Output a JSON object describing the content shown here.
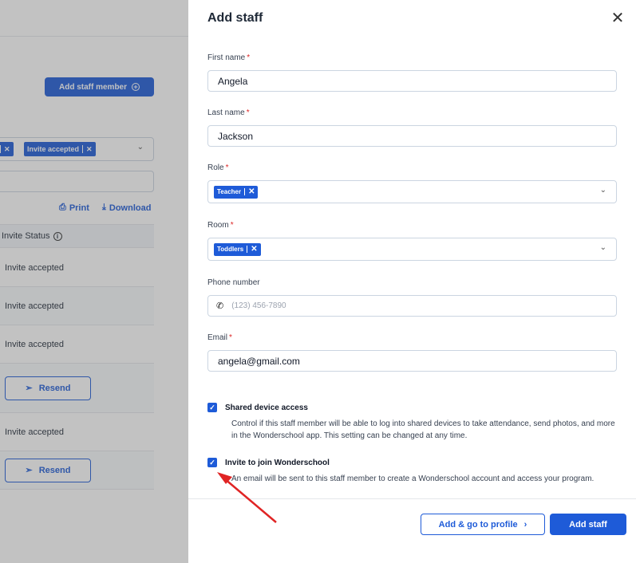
{
  "background": {
    "add_member_label": "Add staff member",
    "filter_chip_1": "",
    "filter_chip_2": "Invite accepted",
    "print_label": "Print",
    "download_label": "Download",
    "column_header": "Invite Status",
    "rows": [
      {
        "status": "Invite accepted"
      },
      {
        "status": "Invite accepted"
      },
      {
        "status": "Invite accepted"
      },
      {
        "button": "Resend"
      },
      {
        "status": "Invite accepted"
      },
      {
        "button": "Resend"
      }
    ]
  },
  "drawer": {
    "title": "Add staff",
    "close_icon": "close-icon",
    "fields": {
      "first_name": {
        "label": "First name",
        "value": "Angela"
      },
      "last_name": {
        "label": "Last name",
        "value": "Jackson"
      },
      "role": {
        "label": "Role",
        "tag": "Teacher"
      },
      "room": {
        "label": "Room",
        "tag": "Toddlers"
      },
      "phone": {
        "label": "Phone number",
        "placeholder": "(123) 456-7890"
      },
      "email": {
        "label": "Email",
        "value": "angela@gmail.com"
      }
    },
    "shared_device": {
      "label": "Shared device access",
      "checked": true,
      "description": "Control if this staff member will be able to log into shared devices to take attendance, send photos, and more in the Wonderschool app. This setting can be changed at any time."
    },
    "invite": {
      "label": "Invite to join Wonderschool",
      "checked": true,
      "description": "An email will be sent to this staff member to create a Wonderschool account and access your program."
    },
    "buttons": {
      "add_go_profile": "Add & go to profile",
      "add_staff": "Add staff"
    }
  },
  "colors": {
    "accent": "#1e5bd8",
    "required": "#dc2626",
    "annotation_arrow": "#e02424"
  }
}
